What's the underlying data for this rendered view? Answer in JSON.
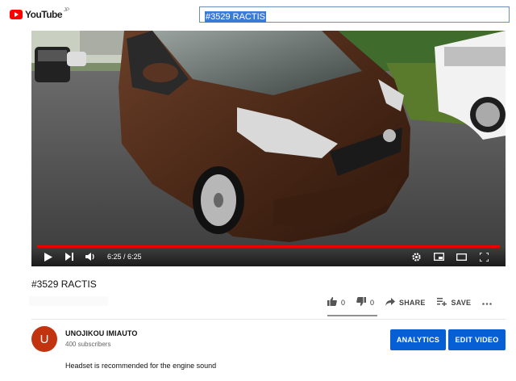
{
  "header": {
    "logo_text": "YouTube",
    "logo_region": "JP",
    "search_value": "#3529 RACTIS"
  },
  "player": {
    "time_display": "6:25 / 6:25",
    "progress": 1.0
  },
  "video": {
    "title": "#3529 RACTIS"
  },
  "actions": {
    "like_count": "0",
    "dislike_count": "0",
    "share_label": "SHARE",
    "save_label": "SAVE"
  },
  "channel": {
    "avatar_letter": "U",
    "name": "UNOJIKOU IMIAUTO",
    "subscribers": "400 subscribers",
    "analytics_label": "ANALYTICS",
    "edit_label": "EDIT VIDEO"
  },
  "description": "Headset  is recommended for the engine sound",
  "colors": {
    "brand_red": "#ff0000",
    "button_blue": "#065fd4",
    "progress_red": "#ee0000",
    "avatar": "#c1340f"
  }
}
